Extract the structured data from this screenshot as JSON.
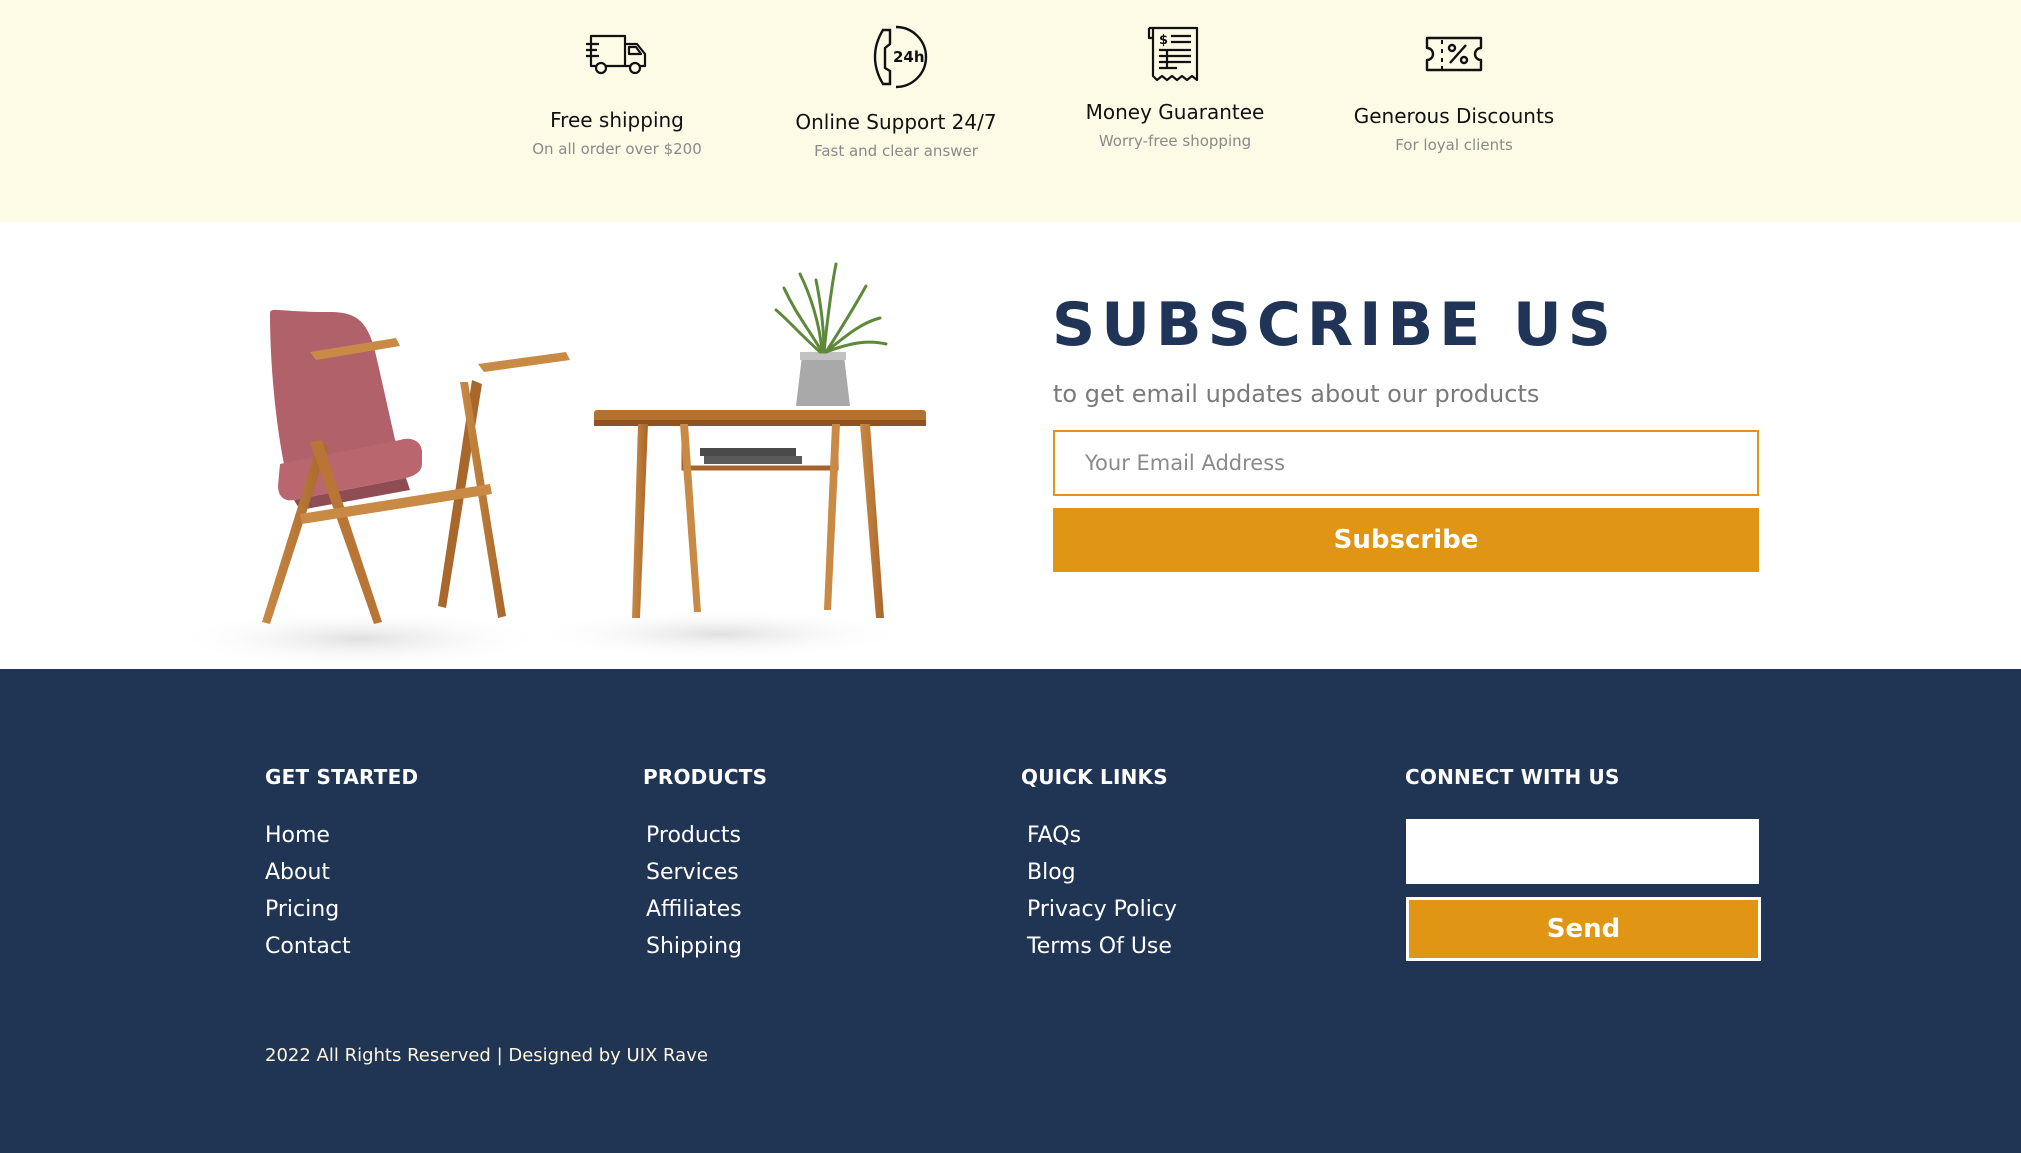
{
  "features": [
    {
      "icon": "delivery-truck-icon",
      "title": "Free shipping",
      "subtitle": "On all order over $200"
    },
    {
      "icon": "support-24h-icon",
      "title": "Online Support 24/7",
      "subtitle": "Fast and clear answer"
    },
    {
      "icon": "receipt-guarantee-icon",
      "title": "Money Guarantee",
      "subtitle": "Worry-free shopping"
    },
    {
      "icon": "discount-coupon-icon",
      "title": "Generous Discounts",
      "subtitle": "For loyal clients"
    }
  ],
  "subscribe": {
    "title": "SUBSCRIBE US",
    "description": "to get email updates about our products",
    "email_placeholder": "Your Email Address",
    "button_label": "Subscribe",
    "image": "armchair-and-side-table-with-plant"
  },
  "footer": {
    "columns": [
      {
        "heading": "GET STARTED",
        "links": [
          "Home",
          "About",
          "Pricing",
          "Contact"
        ]
      },
      {
        "heading": "PRODUCTS",
        "links": [
          "Products",
          "Services",
          "Affiliates",
          "Shipping"
        ]
      },
      {
        "heading": "QUICK LINKS",
        "links": [
          "FAQs",
          "Blog",
          "Privacy Policy",
          "Terms Of Use"
        ]
      }
    ],
    "connect": {
      "heading": "CONNECT WITH US",
      "input_value": "",
      "button_label": "Send"
    },
    "copyright": "2022 All Rights Reserved | Designed by UIX Rave"
  },
  "colors": {
    "navy": "#203454",
    "accent": "#e09614",
    "cream": "#fdfae6"
  }
}
